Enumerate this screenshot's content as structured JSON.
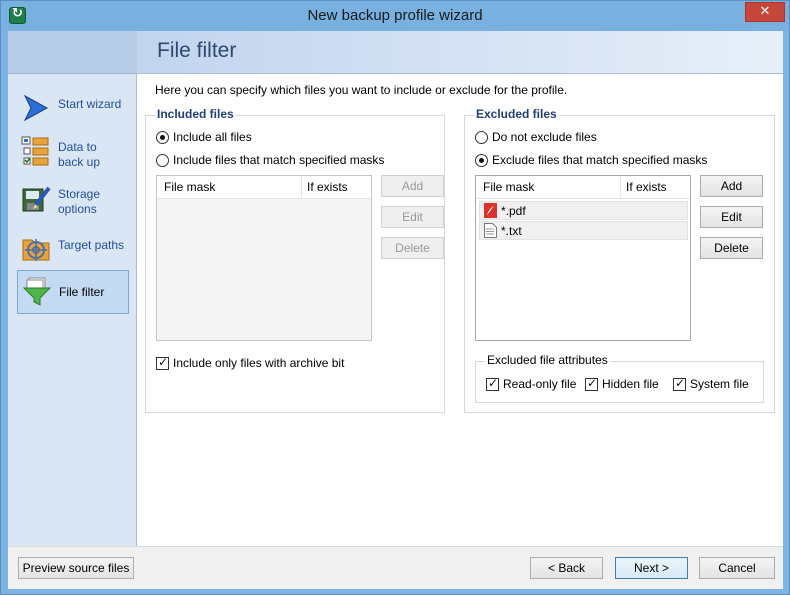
{
  "window": {
    "title": "New backup profile wizard",
    "close_glyph": "✕"
  },
  "header": {
    "title": "File filter"
  },
  "sidebar": {
    "items": [
      {
        "label": "Start wizard",
        "icon": "arrow-icon"
      },
      {
        "label": "Data to\nback up",
        "icon": "folders-tree-icon"
      },
      {
        "label": "Storage\noptions",
        "icon": "disk-pencil-icon"
      },
      {
        "label": "Target paths",
        "icon": "folder-target-icon"
      },
      {
        "label": "File filter",
        "icon": "funnel-icon",
        "active": true
      }
    ]
  },
  "main": {
    "intro": "Here you can specify which files you want to include or exclude for the profile.",
    "included": {
      "title": "Included files",
      "radio_all": "Include all files",
      "radio_masks": "Include files that match specified masks",
      "selected": "all",
      "columns": [
        "File mask",
        "If exists"
      ],
      "rows": [],
      "buttons": {
        "add": "Add",
        "edit": "Edit",
        "delete": "Delete"
      },
      "archive_bit_label": "Include only files with archive bit",
      "archive_bit_checked": true
    },
    "excluded": {
      "title": "Excluded files",
      "radio_none": "Do not exclude files",
      "radio_masks": "Exclude files that match specified masks",
      "selected": "masks",
      "columns": [
        "File mask",
        "If exists"
      ],
      "rows": [
        {
          "mask": "*.pdf",
          "icon": "pdf-file-icon"
        },
        {
          "mask": "*.txt",
          "icon": "text-file-icon"
        }
      ],
      "buttons": {
        "add": "Add",
        "edit": "Edit",
        "delete": "Delete"
      },
      "attributes": {
        "title": "Excluded file attributes",
        "readonly": "Read-only file",
        "hidden": "Hidden file",
        "system": "System file"
      }
    }
  },
  "footer": {
    "preview": "Preview source files",
    "back": "< Back",
    "next": "Next >",
    "cancel": "Cancel"
  },
  "colors": {
    "accent": "#1f4f9a",
    "window_frame": "#7db4e3",
    "close": "#c7463a"
  }
}
